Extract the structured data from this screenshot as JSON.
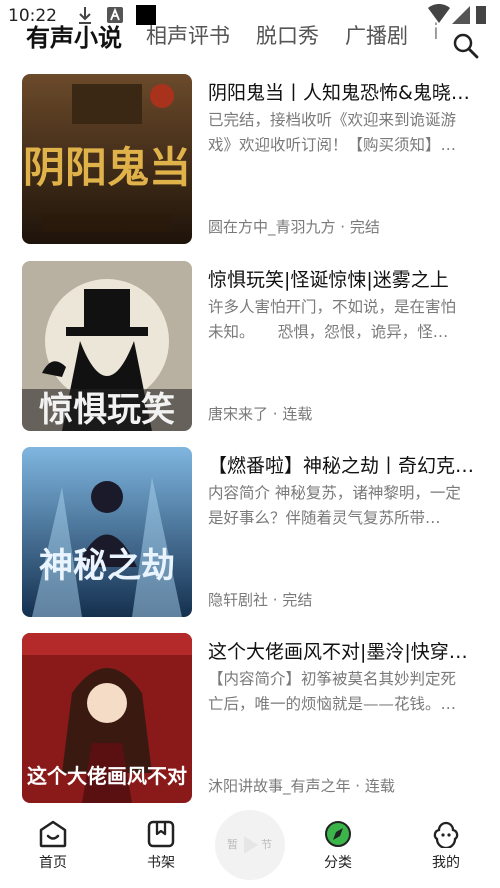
{
  "status_bar": {
    "time": "10:22"
  },
  "tabs": [
    {
      "label": "有声小说",
      "active": true
    },
    {
      "label": "相声评书",
      "active": false
    },
    {
      "label": "脱口秀",
      "active": false
    },
    {
      "label": "广播剧",
      "active": false
    },
    {
      "label": "i",
      "active": false
    }
  ],
  "header": {
    "search_icon": "search-icon"
  },
  "books": [
    {
      "title": "阴阳鬼当丨人知鬼恐怖&鬼晓…",
      "description": "已完结，接档收听《欢迎来到诡诞游戏》欢迎收听订阅！【购买须知】…",
      "author": "圆在方中_青羽九方",
      "status": "完结",
      "cover_text": "阴阳鬼当",
      "cover_colors": [
        "#3a2a1a",
        "#c89a3a"
      ]
    },
    {
      "title": "惊惧玩笑|怪诞惊悚|迷雾之上",
      "description": "许多人害怕开门，不如说，是在害怕未知。　　恐惧，怨恨，诡异，怪…",
      "author": "唐宋来了",
      "status": "连载",
      "cover_text": "惊惧玩笑",
      "cover_colors": [
        "#1a1a1a",
        "#e8e2d4"
      ]
    },
    {
      "title": "【燃番啦】神秘之劫丨奇幻克…",
      "description": "内容简介 神秘复苏，诸神黎明，一定是好事么？伴随着灵气复苏所带…",
      "author": "隐轩剧社",
      "status": "完结",
      "cover_text": "神秘之劫",
      "cover_colors": [
        "#1d3a5e",
        "#7fb6e0"
      ]
    },
    {
      "title": "这个大佬画风不对|墨泠|快穿…",
      "description": "【内容简介】初筝被莫名其妙判定死亡后，唯一的烦恼就是——花钱。…",
      "author": "沐阳讲故事_有声之年",
      "status": "连载",
      "cover_text": "这个大佬画风不对",
      "cover_colors": [
        "#8a1a1a",
        "#f0d8c0"
      ]
    }
  ],
  "meta_separator": " · ",
  "bottom_nav": [
    {
      "label": "首页",
      "icon": "home-icon"
    },
    {
      "label": "书架",
      "icon": "bookshelf-icon"
    },
    {
      "label": "分类",
      "icon": "category-icon"
    },
    {
      "label": "我的",
      "icon": "profile-icon"
    }
  ],
  "player": {
    "left_text": "暂",
    "right_text": "节"
  },
  "colors": {
    "accent": "#3bb54a",
    "text_primary": "#111111",
    "text_secondary": "#7a7a7a"
  }
}
